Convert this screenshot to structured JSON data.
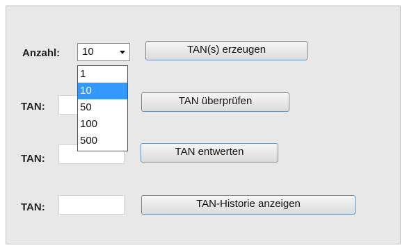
{
  "form": {
    "anzahl_label": "Anzahl:",
    "anzahl_value": "10",
    "anzahl_options": [
      "1",
      "10",
      "50",
      "100",
      "500"
    ],
    "selected_option": "10",
    "tan_label": "TAN:",
    "tan1_value": "",
    "tan2_value": "",
    "tan3_value": "",
    "btn_erzeugen": "TAN(s) erzeugen",
    "btn_pruefen": "TAN überprüfen",
    "btn_entwerten": "TAN entwerten",
    "btn_historie": "TAN-Historie anzeigen"
  },
  "colors": {
    "panel_bg": "#e8e8e8",
    "selection": "#3399ff",
    "button_border": "#6b8fb3"
  },
  "icons": {
    "dropdown_arrow": "chevron-down-icon"
  }
}
